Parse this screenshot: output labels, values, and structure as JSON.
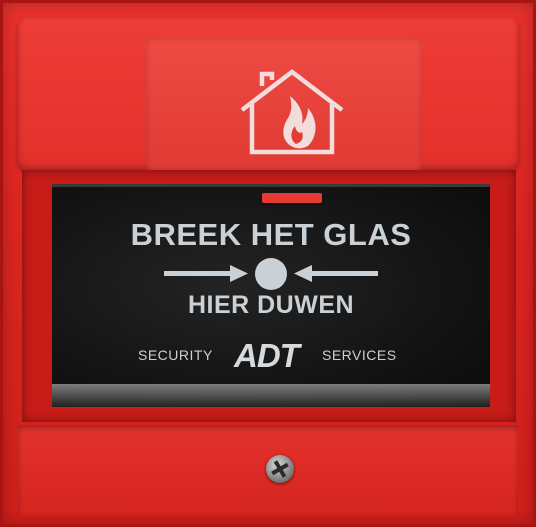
{
  "device": {
    "headline": "BREEK HET GLAS",
    "subline": "HIER DUWEN",
    "brand_left": "SECURITY",
    "brand_logo": "ADT",
    "brand_right": "SERVICES"
  },
  "icons": {
    "top_symbol": "house-fire-icon",
    "push_arrows": "push-arrows-icon",
    "screw": "screw-icon"
  },
  "colors": {
    "housing": "#dc2622",
    "glass": "#141414",
    "lettering": "#c9d1d6"
  }
}
